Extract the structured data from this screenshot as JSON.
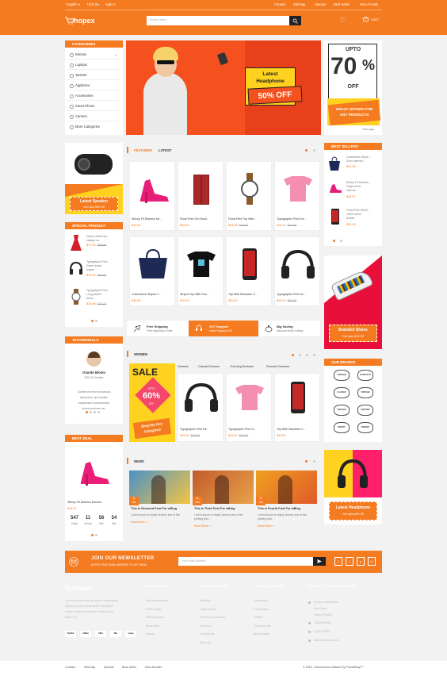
{
  "topbar": {
    "lang": "English",
    "currency": "USD $",
    "signin": "Sign in",
    "links": [
      "Contact",
      "Sitemap",
      "Special",
      "Best Seller",
      "New Arrivals"
    ]
  },
  "header": {
    "logo": "hopex",
    "search_placeholder": "Search here...",
    "cart": "CART"
  },
  "categories": {
    "title": "CATEGORIES",
    "items": [
      "Women",
      "Laptops",
      "Jackets",
      "Appliance",
      "Accessories",
      "Smart Phone",
      "Camera",
      "More Categories"
    ]
  },
  "hero": {
    "tag": "Latest",
    "title": "Headphone",
    "offer": "50% OFF"
  },
  "promo": {
    "upto": "UPTO",
    "pct": "70",
    "pct_sign": "%",
    "off": "OFF",
    "line1": "CRAZY OFFERS FOR",
    "line2": "ANY PRODUCTS",
    "note": "*T&C Apply"
  },
  "speaker_banner": {
    "title": "Latest Speaker",
    "sub": "Get Upto 35% Off"
  },
  "featured": {
    "tabs": [
      "FEATURED",
      "LATEST"
    ],
    "products": [
      {
        "name": "Skinny Fit Distress De...",
        "price": "$16.51",
        "old": ""
      },
      {
        "name": "Floral Print Off-Shoul...",
        "price": "$35.99",
        "old": ""
      },
      {
        "name": "Floral Print Top With ...",
        "price": "$28.98",
        "old": "$30.00"
      },
      {
        "name": "Typographic Print Cre...",
        "price": "$16.40",
        "old": "$20.00"
      },
      {
        "name": "Colourblock Striped T...",
        "price": "$38.99",
        "old": ""
      },
      {
        "name": "Striped Top With Pan...",
        "price": "$10.99",
        "old": ""
      },
      {
        "name": "Top With Mandarin C...",
        "price": "$30.50",
        "old": ""
      },
      {
        "name": "Typographic Print Ho...",
        "price": "$49.00",
        "old": "$50.00"
      }
    ]
  },
  "services": [
    {
      "title": "Free Shipping",
      "sub": "Free shipping in India"
    },
    {
      "title": "24/7 Support",
      "sub": "online Support 24/7"
    },
    {
      "title": "Big Saving",
      "sub": "discount every holiday"
    }
  ],
  "special": {
    "title": "SPECIAL PRODUCT",
    "items": [
      {
        "l1": "Denim Jacket wit...",
        "l2": "categor-eu",
        "price": "$79.05",
        "old": "$85.00"
      },
      {
        "l1": "Typographic Print ...",
        "l2": "Dones turpis",
        "l3": "augue,...",
        "price": "$49.00",
        "old": "$50.00"
      },
      {
        "l1": "Typographic Print...",
        "l2": "Long printed",
        "l3": "dress...",
        "price": "$28.98",
        "old": "$30.00"
      }
    ]
  },
  "testimonials": {
    "title": "TESTIMONIALS",
    "name": "Orando Bloom",
    "role": "CEO & Founder",
    "text": [
      "Clorites est enim processus",
      "dynamicus, qui sequitur",
      "mutationem consuetudium",
      "lectorum mirum est."
    ]
  },
  "best_deal": {
    "title": "BEST DEAL",
    "name": "Skinny Fit Distress Denims",
    "price": "$16.51",
    "timer": [
      {
        "v": "547",
        "l": "Days"
      },
      {
        "v": "11",
        "l": "Hours"
      },
      {
        "v": "56",
        "l": "Min"
      },
      {
        "v": "54",
        "l": "Sec"
      }
    ]
  },
  "women": {
    "title": "WOMEN",
    "tabs": [
      "Dresses",
      "Casual Dresses",
      "Evening Dresses",
      "Summer Dresses"
    ],
    "sale": {
      "word": "SALE",
      "upto": "UPTO",
      "pct": "60%",
      "off": "OFF",
      "cta1": "Shop By Any",
      "cta2": "Categorys"
    },
    "products": [
      {
        "name": "Typographic Print He...",
        "price": "$49.00",
        "old": "$50.00"
      },
      {
        "name": "Typographic Print Cr...",
        "price": "$16.40",
        "old": "$20.00"
      },
      {
        "name": "Top With Mandarin C...",
        "price": "$30.50",
        "old": ""
      }
    ]
  },
  "news": {
    "title": "NEWS",
    "posts": [
      {
        "day": "11",
        "mon": "Jan",
        "title": "This is Secound Post For wBlog",
        "text": [
          "Lorem Ipsum is simply dummy text of the"
        ],
        "more": "Read More »"
      },
      {
        "day": "11",
        "mon": "Jan",
        "title": "This is Third Post For wBlog",
        "text": [
          "Lorem Ipsum is simply dummy text of the",
          "printing and ..."
        ],
        "more": "Read More »"
      },
      {
        "day": "11",
        "mon": "Jan",
        "title": "This is Fourth Post For wBlog",
        "text": [
          "Lorem Ipsum is simply dummy text of the",
          "printing and ..."
        ],
        "more": "Read More »"
      }
    ]
  },
  "best_sellers": {
    "title": "BEST SELLERS",
    "items": [
      {
        "l1": "Colourblock Stripe...",
        "l2": "Short sleeved...",
        "price": "$26.99"
      },
      {
        "l1": "Skinny Fit Distress...",
        "l2": "Faded short",
        "l3": "sleeves...",
        "price": "$16.51"
      },
      {
        "l1": "Floral Print Off-Sh...",
        "l2": "100% cotton",
        "l3": "double...",
        "price": "$25.99"
      }
    ]
  },
  "branded_banner": {
    "title": "Branded Shoes",
    "sub": "Get Upto 30% Off"
  },
  "brands": {
    "title": "OUR BRANDS",
    "items": [
      "VINTAGE",
      "LIFESTYLE",
      "CLASSIC",
      "VINTAGE",
      "VINTAGE",
      "HIPSTER",
      "RETRO",
      "TRENDY"
    ]
  },
  "headphone_banner": {
    "title": "Latest Headphone",
    "sub": "Get Upto 40% Off"
  },
  "newsletter": {
    "title": "JOIN OUR NEWSLETTER",
    "sub": "ENTER YOUR EMAIL ADDRESS TO GET NEWS",
    "placeholder": "Your email address",
    "social": [
      "f",
      "t",
      "p",
      "in"
    ]
  },
  "footer": {
    "about": [
      "Lorem ipsum dolor sit amet, consectetur",
      "adipiscing elit consectetur incididunt",
      "sed do eiusmod tempor incididunt ut",
      "labore et."
    ],
    "payments": [
      "PayPal",
      "AMEX",
      "VISA",
      "MC",
      "stripe"
    ],
    "cols": [
      {
        "title": "PRODUCTS",
        "links": [
          "Secure payment",
          "Prices drop",
          "New products",
          "Best sales",
          "Stores"
        ]
      },
      {
        "title": "OUR COMPANY",
        "links": [
          "Delivery",
          "Legal Notice",
          "Terms & conditions",
          "About us",
          "Contact us",
          "Sitemap"
        ]
      },
      {
        "title": "YOUR ACCOUNT",
        "links": [
          "Addresses",
          "Credit slips",
          "Orders",
          "Personal info",
          "My wishlists"
        ]
      }
    ],
    "contact": {
      "title": "CONTACT INFORMATION",
      "lines": [
        "Shopex Multistore",
        "Any Town,",
        "United States",
        "1234567890",
        "0125-56785",
        "demo@demo.com"
      ]
    },
    "bottom_links": [
      "Contact",
      "Sitemap",
      "Special",
      "Best Seller",
      "New Arrivals"
    ],
    "copyright": "© 2016 - Ecommerce software by PrestaShop™"
  },
  "colors": {
    "accent": "#f47b20",
    "dark": "#111111"
  }
}
